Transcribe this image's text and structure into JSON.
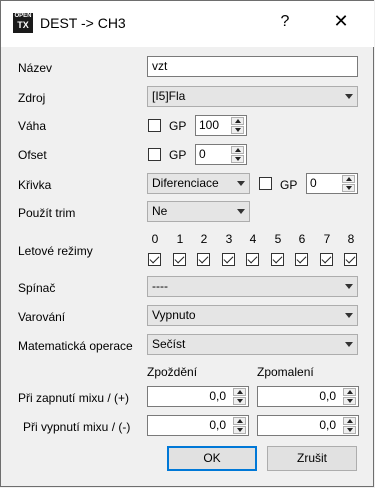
{
  "window": {
    "logo_top": "OPEN",
    "logo_bottom": "TX",
    "title": "DEST -> CH3",
    "help_glyph": "?",
    "close_glyph": "✕"
  },
  "form": {
    "name_label": "Název",
    "name_value": "vzt",
    "source_label": "Zdroj",
    "source_value": "[I5]Fla",
    "weight_label": "Váha",
    "weight_gp_label": "GP",
    "weight_gp_checked": false,
    "weight_value": "100",
    "offset_label": "Ofset",
    "offset_gp_label": "GP",
    "offset_gp_checked": false,
    "offset_value": "0",
    "curve_label": "Křivka",
    "curve_type_value": "Diferenciace",
    "curve_gp_label": "GP",
    "curve_gp_checked": false,
    "curve_value": "0",
    "trim_label": "Použít trim",
    "trim_value": "Ne",
    "flight_modes_label": "Letové režimy",
    "flight_modes": [
      {
        "num": "0",
        "checked": true
      },
      {
        "num": "1",
        "checked": true
      },
      {
        "num": "2",
        "checked": true
      },
      {
        "num": "3",
        "checked": true
      },
      {
        "num": "4",
        "checked": true
      },
      {
        "num": "5",
        "checked": true
      },
      {
        "num": "6",
        "checked": true
      },
      {
        "num": "7",
        "checked": true
      },
      {
        "num": "8",
        "checked": true
      }
    ],
    "switch_label": "Spínač",
    "switch_value": "----",
    "warning_label": "Varování",
    "warning_value": "Vypnuto",
    "math_label": "Matematická operace",
    "math_value": "Sečíst",
    "delay_header": "Zpoždění",
    "slow_header": "Zpomalení",
    "on_label": "Při zapnutí mixu / (+)",
    "off_label": "Při vypnutí mixu / (-)",
    "delay_on_value": "0,0",
    "slow_on_value": "0,0",
    "delay_off_value": "0,0",
    "slow_off_value": "0,0"
  },
  "buttons": {
    "ok": "OK",
    "cancel": "Zrušit"
  }
}
